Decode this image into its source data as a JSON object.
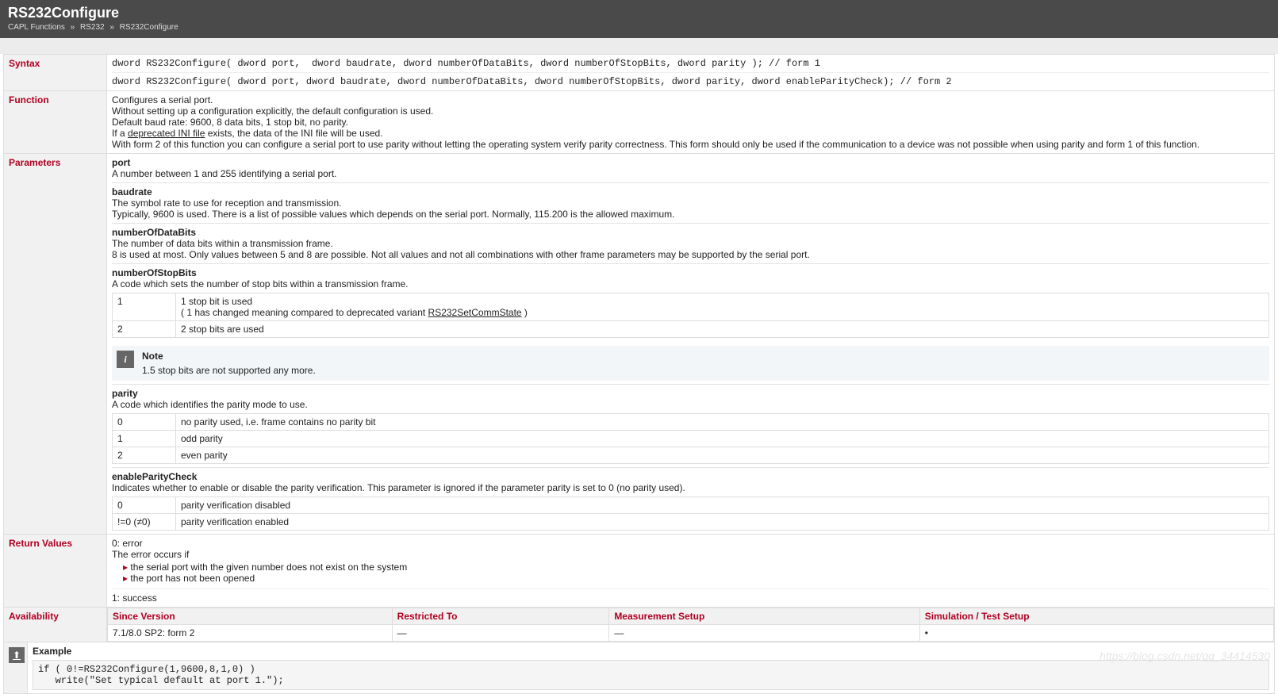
{
  "header": {
    "title": "RS232Configure",
    "breadcrumb": [
      "CAPL Functions",
      "RS232",
      "RS232Configure"
    ]
  },
  "syntax": {
    "label": "Syntax",
    "line1": "dword RS232Configure( dword port,  dword baudrate, dword numberOfDataBits, dword numberOfStopBits, dword parity ); // form 1",
    "line2": "dword RS232Configure( dword port, dword baudrate, dword numberOfDataBits, dword numberOfStopBits, dword parity, dword enableParityCheck); // form 2"
  },
  "function": {
    "label": "Function",
    "l1": "Configures a serial port.",
    "l2": "Without setting up a configuration explicitly, the default configuration is used.",
    "l3": "Default baud rate: 9600, 8 data bits, 1 stop bit, no parity.",
    "l4a": "If a ",
    "l4link": "deprecated INI file",
    "l4b": " exists, the data of the INI file will be used.",
    "l5": "With form 2 of this function you can configure a serial port to use parity without letting the operating system verify parity correctness. This form should only be used if the communication to a device was not possible when using parity and form 1 of this function."
  },
  "parameters": {
    "label": "Parameters",
    "port": {
      "name": "port",
      "desc": "A number between 1 and 255 identifying a serial port."
    },
    "baudrate": {
      "name": "baudrate",
      "d1": "The symbol rate to use for reception and transmission.",
      "d2": "Typically, 9600 is used. There is a list of possible values which depends on the serial port. Normally, 115.200 is the allowed maximum."
    },
    "databits": {
      "name": "numberOfDataBits",
      "d1": "The number of data bits within a transmission frame.",
      "d2": "8 is used at most. Only values between 5 and 8 are possible. Not all values and not all combinations with other frame parameters may be supported by the serial port."
    },
    "stopbits": {
      "name": "numberOfStopBits",
      "d1": "A code which sets the number of stop bits within a transmission frame.",
      "rows": [
        {
          "k": "1",
          "v_a": "1 stop bit is used",
          "v_b": "( 1 has changed meaning compared to deprecated variant ",
          "v_link": "RS232SetCommState",
          "v_c": " )"
        },
        {
          "k": "2",
          "v_a": "2 stop bits are used"
        }
      ],
      "note_title": "Note",
      "note_body": "1.5 stop bits are not supported any more."
    },
    "parity": {
      "name": "parity",
      "d1": "A code which identifies the parity mode to use.",
      "rows": [
        {
          "k": "0",
          "v": "no parity used, i.e. frame contains no parity bit"
        },
        {
          "k": "1",
          "v": "odd parity"
        },
        {
          "k": "2",
          "v": "even parity"
        }
      ]
    },
    "enablepc": {
      "name": "enableParityCheck",
      "d1": "Indicates whether to enable or disable the parity verification. This parameter is ignored if the parameter parity is set to 0 (no parity used).",
      "rows": [
        {
          "k": "0",
          "v": "parity verification disabled"
        },
        {
          "k": "!=0 (≠0)",
          "v": "parity verification enabled"
        }
      ]
    }
  },
  "returns": {
    "label": "Return Values",
    "l1": "0: error",
    "l2": "The error occurs if",
    "b1": "the serial port with the given number does not exist on the system",
    "b2": "the port has not been opened",
    "l3": "1: success"
  },
  "availability": {
    "label": "Availability",
    "h1": "Since Version",
    "h2": "Restricted To",
    "h3": "Measurement Setup",
    "h4": "Simulation / Test Setup",
    "r1": "7.1/8.0 SP2: form 2",
    "r2": "—",
    "r3": "—",
    "r4": "•"
  },
  "example": {
    "label": "Example",
    "code": "if ( 0!=RS232Configure(1,9600,8,1,0) )\n   write(\"Set typical default at port 1.\");"
  },
  "watermark": "https://blog.csdn.net/qq_34414530"
}
